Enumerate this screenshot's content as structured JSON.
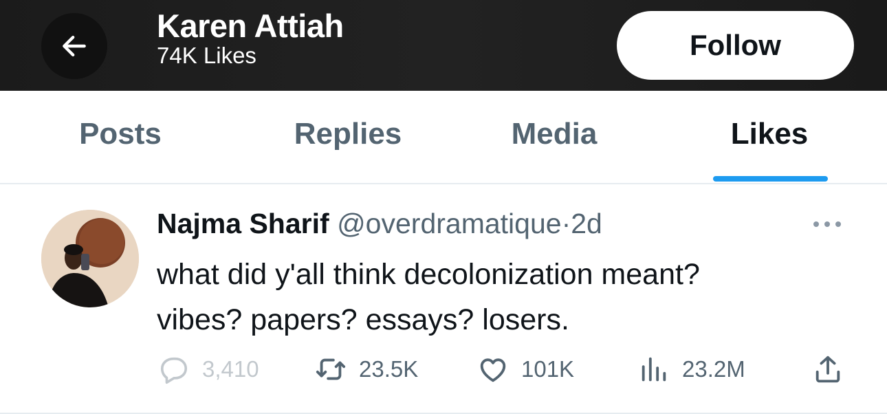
{
  "header": {
    "name": "Karen Attiah",
    "likes_count": "74K Likes",
    "follow_label": "Follow"
  },
  "tabs": [
    {
      "label": "Posts",
      "active": false
    },
    {
      "label": "Replies",
      "active": false
    },
    {
      "label": "Media",
      "active": false
    },
    {
      "label": "Likes",
      "active": true
    }
  ],
  "post": {
    "author_name": "Najma Sharif",
    "author_handle": "@overdramatique",
    "separator": "·",
    "time": "2d",
    "text_lines": [
      "what did y'all think decolonization meant?",
      "vibes? papers? essays? losers."
    ],
    "actions": {
      "replies": "3,410",
      "reposts": "23.5K",
      "likes": "101K",
      "views": "23.2M"
    }
  },
  "icons": {
    "back": "arrow-left-icon",
    "more": "more-horizontal-icon",
    "reply": "reply-bubble-icon",
    "repost": "repost-icon",
    "like": "heart-icon",
    "views": "bar-chart-icon",
    "share": "share-icon"
  },
  "colors": {
    "accent": "#1d9bf0",
    "secondary_text": "#536471",
    "header_bg": "#1b1b1b"
  }
}
